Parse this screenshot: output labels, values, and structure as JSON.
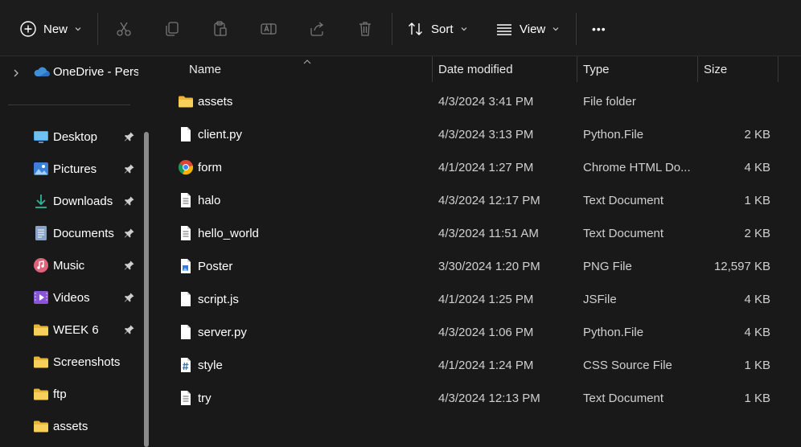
{
  "toolbar": {
    "new_label": "New",
    "sort_label": "Sort",
    "view_label": "View",
    "more_label": "•••"
  },
  "sidebar": {
    "onedrive_label": "OneDrive - Personal",
    "items": [
      {
        "label": "Desktop",
        "icon": "desktop-icon",
        "pinned": true
      },
      {
        "label": "Pictures",
        "icon": "pictures-icon",
        "pinned": true
      },
      {
        "label": "Downloads",
        "icon": "downloads-icon",
        "pinned": true
      },
      {
        "label": "Documents",
        "icon": "documents-icon",
        "pinned": true
      },
      {
        "label": "Music",
        "icon": "music-icon",
        "pinned": true
      },
      {
        "label": "Videos",
        "icon": "videos-icon",
        "pinned": true
      },
      {
        "label": "WEEK 6",
        "icon": "folder-icon",
        "pinned": true
      },
      {
        "label": "Screenshots",
        "icon": "folder-icon",
        "pinned": false
      },
      {
        "label": "ftp",
        "icon": "folder-icon",
        "pinned": false
      },
      {
        "label": "assets",
        "icon": "folder-icon",
        "pinned": false
      }
    ]
  },
  "columns": {
    "name": "Name",
    "date": "Date modified",
    "type": "Type",
    "size": "Size"
  },
  "files": [
    {
      "name": "assets",
      "date": "4/3/2024 3:41 PM",
      "type": "File folder",
      "size": "",
      "icon": "folder-icon"
    },
    {
      "name": "client.py",
      "date": "4/3/2024 3:13 PM",
      "type": "Python.File",
      "size": "2 KB",
      "icon": "file-icon"
    },
    {
      "name": "form",
      "date": "4/1/2024 1:27 PM",
      "type": "Chrome HTML Do...",
      "size": "4 KB",
      "icon": "chrome-icon"
    },
    {
      "name": "halo",
      "date": "4/3/2024 12:17 PM",
      "type": "Text Document",
      "size": "1 KB",
      "icon": "text-doc-icon"
    },
    {
      "name": "hello_world",
      "date": "4/3/2024 11:51 AM",
      "type": "Text Document",
      "size": "2 KB",
      "icon": "text-doc-icon"
    },
    {
      "name": "Poster",
      "date": "3/30/2024 1:20 PM",
      "type": "PNG File",
      "size": "12,597 KB",
      "icon": "image-file-icon"
    },
    {
      "name": "script.js",
      "date": "4/1/2024 1:25 PM",
      "type": "JSFile",
      "size": "4 KB",
      "icon": "file-icon"
    },
    {
      "name": "server.py",
      "date": "4/3/2024 1:06 PM",
      "type": "Python.File",
      "size": "4 KB",
      "icon": "file-icon"
    },
    {
      "name": "style",
      "date": "4/1/2024 1:24 PM",
      "type": "CSS Source File",
      "size": "1 KB",
      "icon": "css-file-icon"
    },
    {
      "name": "try",
      "date": "4/3/2024 12:13 PM",
      "type": "Text Document",
      "size": "1 KB",
      "icon": "text-doc-icon"
    }
  ],
  "colors": {
    "background": "#191919",
    "folder": "#f4c542",
    "onedrive": "#3b8fdb",
    "divider": "#3a3a3a"
  }
}
